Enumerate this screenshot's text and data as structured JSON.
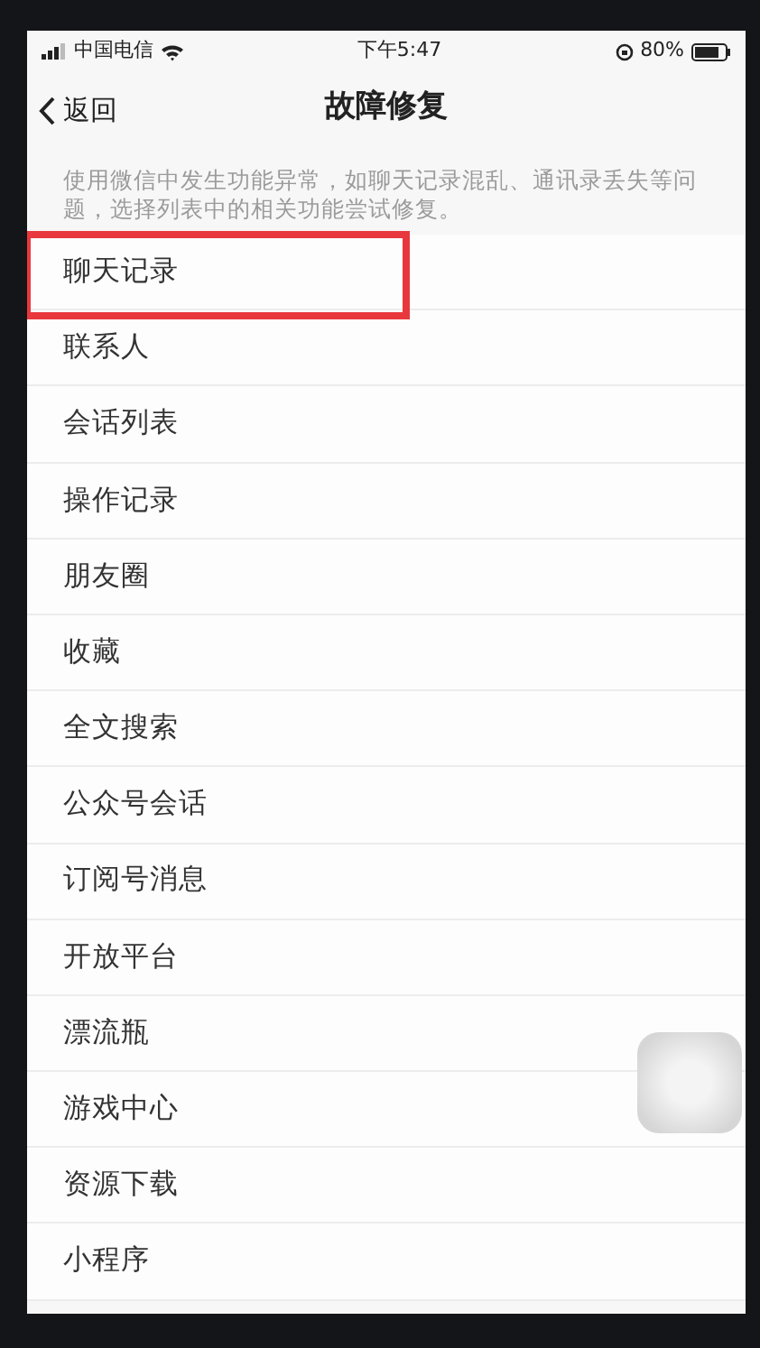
{
  "status_bar": {
    "carrier": "中国电信",
    "time": "下午5:47",
    "battery": "80%"
  },
  "nav": {
    "back": "返回",
    "title": "故障修复"
  },
  "description": "使用微信中发生功能异常，如聊天记录混乱、通讯录丢失等问题，选择列表中的相关功能尝试修复。",
  "items": [
    {
      "label": "聊天记录",
      "highlighted": true
    },
    {
      "label": "联系人",
      "highlighted": false
    },
    {
      "label": "会话列表",
      "highlighted": false
    },
    {
      "label": "操作记录",
      "highlighted": false
    },
    {
      "label": "朋友圈",
      "highlighted": false
    },
    {
      "label": "收藏",
      "highlighted": false
    },
    {
      "label": "全文搜索",
      "highlighted": false
    },
    {
      "label": "公众号会话",
      "highlighted": false
    },
    {
      "label": "订阅号消息",
      "highlighted": false
    },
    {
      "label": "开放平台",
      "highlighted": false
    },
    {
      "label": "漂流瓶",
      "highlighted": false
    },
    {
      "label": "游戏中心",
      "highlighted": false
    },
    {
      "label": "资源下载",
      "highlighted": false
    },
    {
      "label": "小程序",
      "highlighted": false
    }
  ]
}
